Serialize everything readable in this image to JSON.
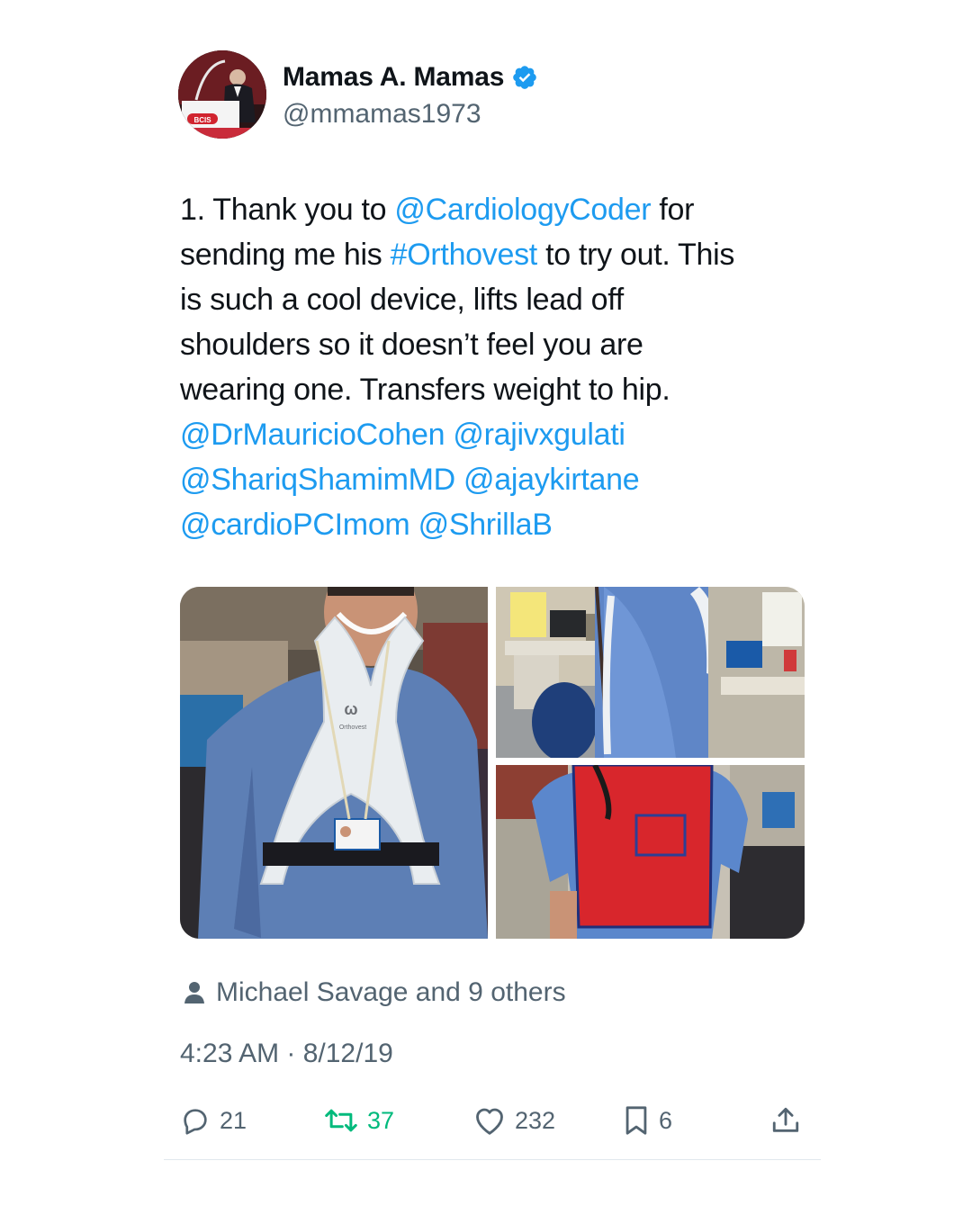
{
  "author": {
    "display_name": "Mamas A. Mamas",
    "handle": "@mmamas1973",
    "verified": true,
    "avatar_badge_text": "BCIS"
  },
  "tweet": {
    "lines": [
      [
        {
          "text": "1. Thank you to ",
          "type": "text"
        },
        {
          "text": "@CardiologyCoder",
          "type": "mention"
        },
        {
          "text": " for",
          "type": "text"
        }
      ],
      [
        {
          "text": "sending me his ",
          "type": "text"
        },
        {
          "text": "#Orthovest",
          "type": "hashtag"
        },
        {
          "text": " to try out. This",
          "type": "text"
        }
      ],
      [
        {
          "text": "is such a cool device, lifts lead off",
          "type": "text"
        }
      ],
      [
        {
          "text": "shoulders so it doesn’t feel you are",
          "type": "text"
        }
      ],
      [
        {
          "text": "wearing one. Transfers weight to hip.",
          "type": "text"
        }
      ],
      [
        {
          "text": "@DrMauricioCohen",
          "type": "mention"
        },
        {
          "text": " ",
          "type": "text"
        },
        {
          "text": "@rajivxgulati",
          "type": "mention"
        }
      ],
      [
        {
          "text": "@ShariqShamimMD",
          "type": "mention"
        },
        {
          "text": " ",
          "type": "text"
        },
        {
          "text": "@ajaykirtane",
          "type": "mention"
        }
      ],
      [
        {
          "text": "@cardioPCImom",
          "type": "mention"
        },
        {
          "text": " ",
          "type": "text"
        },
        {
          "text": "@ShrillaB",
          "type": "mention"
        }
      ]
    ]
  },
  "media": {
    "photos": [
      {
        "description": "man in blue scrubs wearing white Orthovest frame",
        "vest_logo_text": "Orthovest"
      },
      {
        "description": "side view of man in scrubs wearing Orthovest frame"
      },
      {
        "description": "man wearing red lead apron over Orthovest"
      }
    ]
  },
  "liked_by": {
    "text": "Michael Savage and 9 others"
  },
  "timestamp": "4:23 AM · 8/12/19",
  "actions": {
    "replies": "21",
    "retweets": "37",
    "likes": "232",
    "bookmarks": "6"
  },
  "colors": {
    "link": "#1d9bf0",
    "secondary_text": "#536471",
    "retweet_green": "#00ba7c",
    "verified_blue": "#1d9bf0"
  }
}
